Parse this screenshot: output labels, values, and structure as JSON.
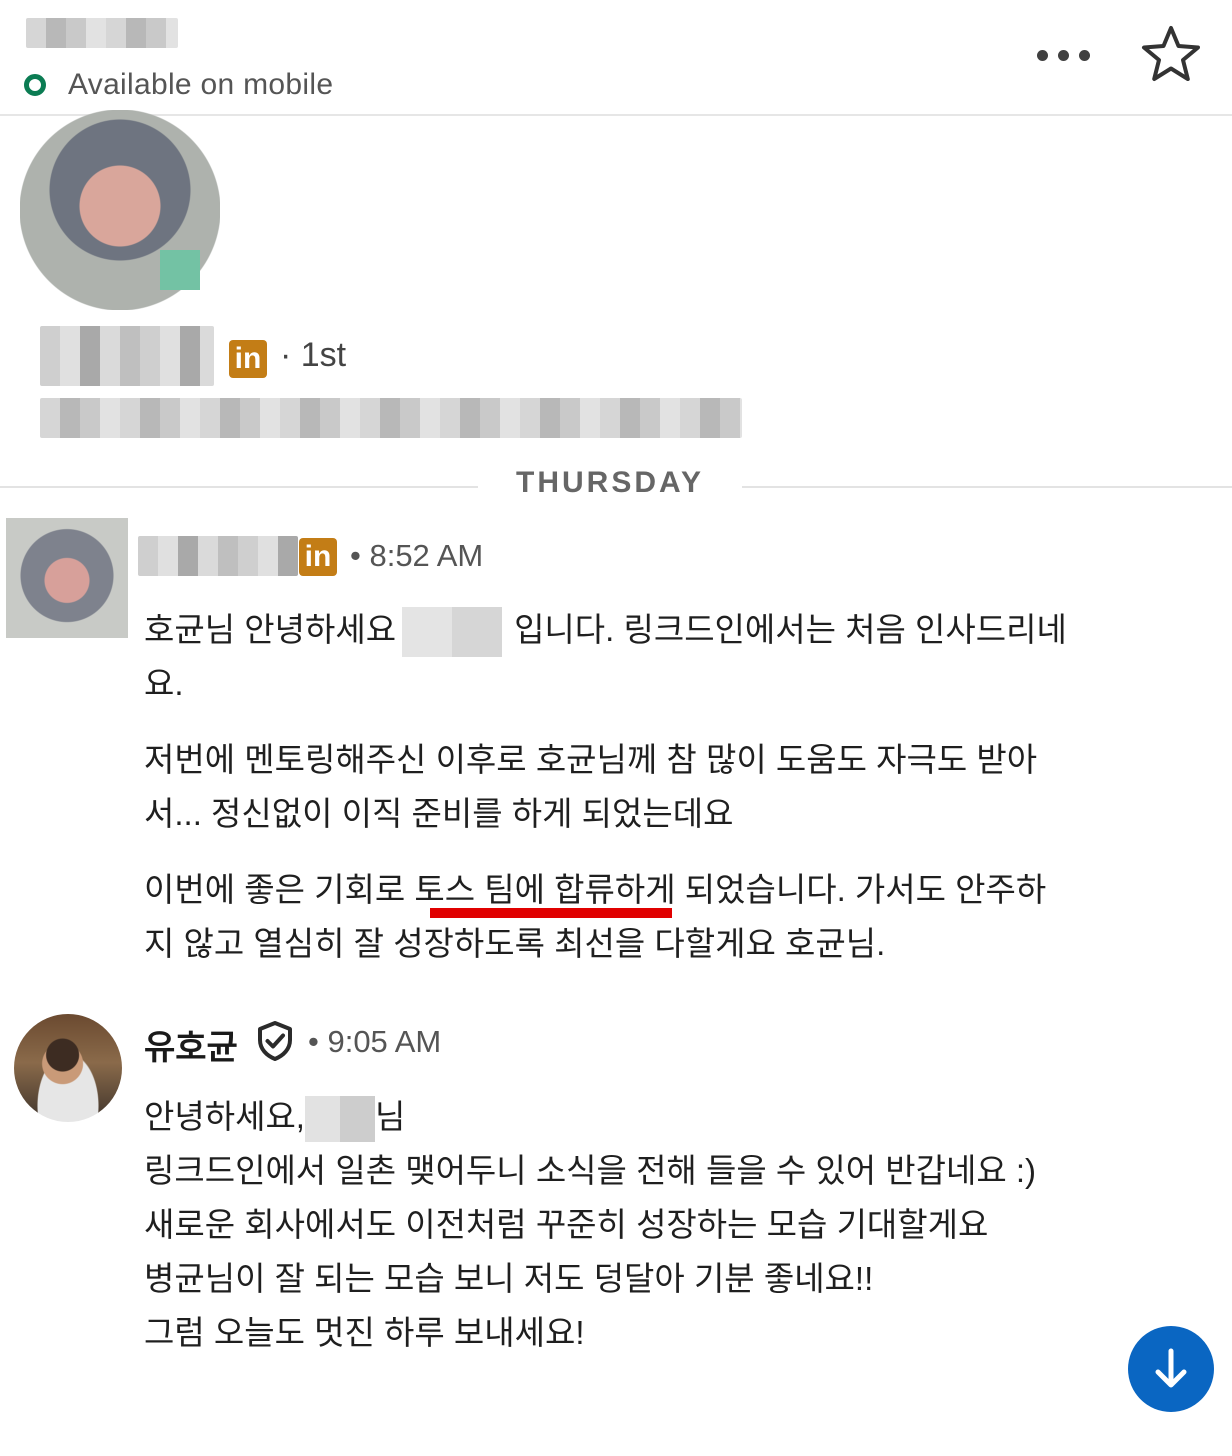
{
  "header": {
    "status_text": "Available on mobile",
    "status_color": "#0b7c53",
    "more_icon": "more-horizontal-icon",
    "star_icon": "star-icon"
  },
  "profile": {
    "connection_degree": "· 1st",
    "linkedin_badge": "in"
  },
  "divider": {
    "day_label": "THURSDAY"
  },
  "messages": [
    {
      "linkedin_badge": "in",
      "time": "• 8:52 AM",
      "para1_a": "호균님 안녕하세요",
      "para1_b": "입니다. 링크드인에서는 처음 인사드리네요.",
      "para2": "저번에 멘토링해주신 이후로 호균님께 참 많이 도움도 자극도 받아서... 정신없이 이직 준비를 하게 되었는데요",
      "para3": "이번에 좋은 기회로 토스 팀에 합류하게 되었습니다. 가서도 안주하지 않고 열심히 잘 성장하도록 최선을 다할게요 호균님."
    },
    {
      "sender": "유호균",
      "verified_icon": "verified-shield-icon",
      "time": "• 9:05 AM",
      "line1_a": "안녕하세요,",
      "line1_b": "님",
      "body": "링크드인에서 일촌 맺어두니 소식을 전해 들을 수 있어 반갑네요 :)\n새로운 회사에서도 이전처럼 꾸준히 성장하는 모습 기대할게요\n병균님이 잘 되는 모습 보니 저도 덩달아 기분 좋네요!!\n그럼 오늘도 멋진 하루 보내세요!"
    }
  ],
  "colors": {
    "accent": "#0a66c2",
    "linkedin_badge": "#c37d16",
    "highlight_underline": "#e00000"
  }
}
